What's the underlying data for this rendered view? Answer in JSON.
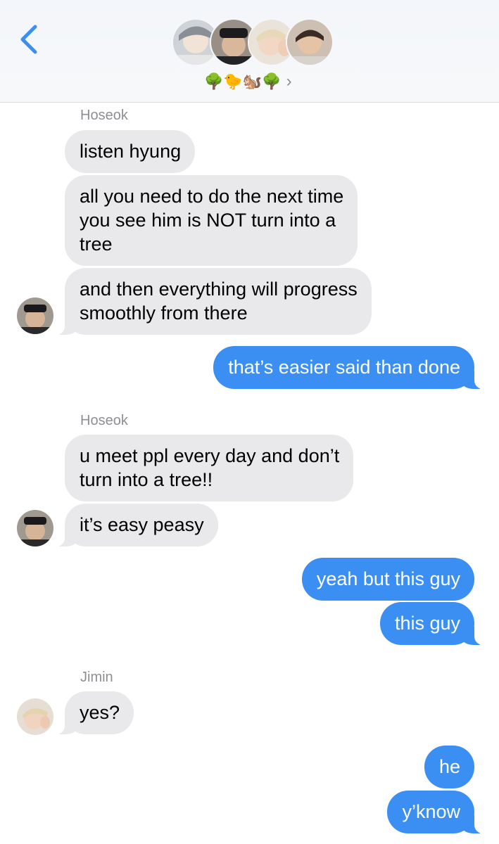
{
  "header": {
    "back_icon": "chevron-left-icon",
    "group_avatars": [
      "avatar-1",
      "avatar-2",
      "avatar-3",
      "avatar-4"
    ],
    "group_name": "🌳🐤🐿️🌳",
    "chevron_icon": "chevron-right-icon",
    "accent_color": "#3b8ff2"
  },
  "messages": [
    {
      "sender_label": "Hoseok"
    },
    {
      "text": "listen hyung"
    },
    {
      "lines": [
        "all you need to do the next time",
        "you see him is NOT turn into a",
        "tree"
      ]
    },
    {
      "lines": [
        "and then everything will progress",
        "smoothly from there"
      ]
    },
    {
      "text": "that’s easier said than done"
    },
    {
      "sender_label": "Hoseok"
    },
    {
      "lines": [
        "u meet ppl every day and don’t",
        "turn into a tree!!"
      ]
    },
    {
      "text": "it’s easy peasy"
    },
    {
      "text": "yeah but this guy"
    },
    {
      "text": "this guy"
    },
    {
      "sender_label": "Jimin"
    },
    {
      "text": "yes?"
    },
    {
      "text": "he"
    },
    {
      "text": "y’know"
    }
  ]
}
